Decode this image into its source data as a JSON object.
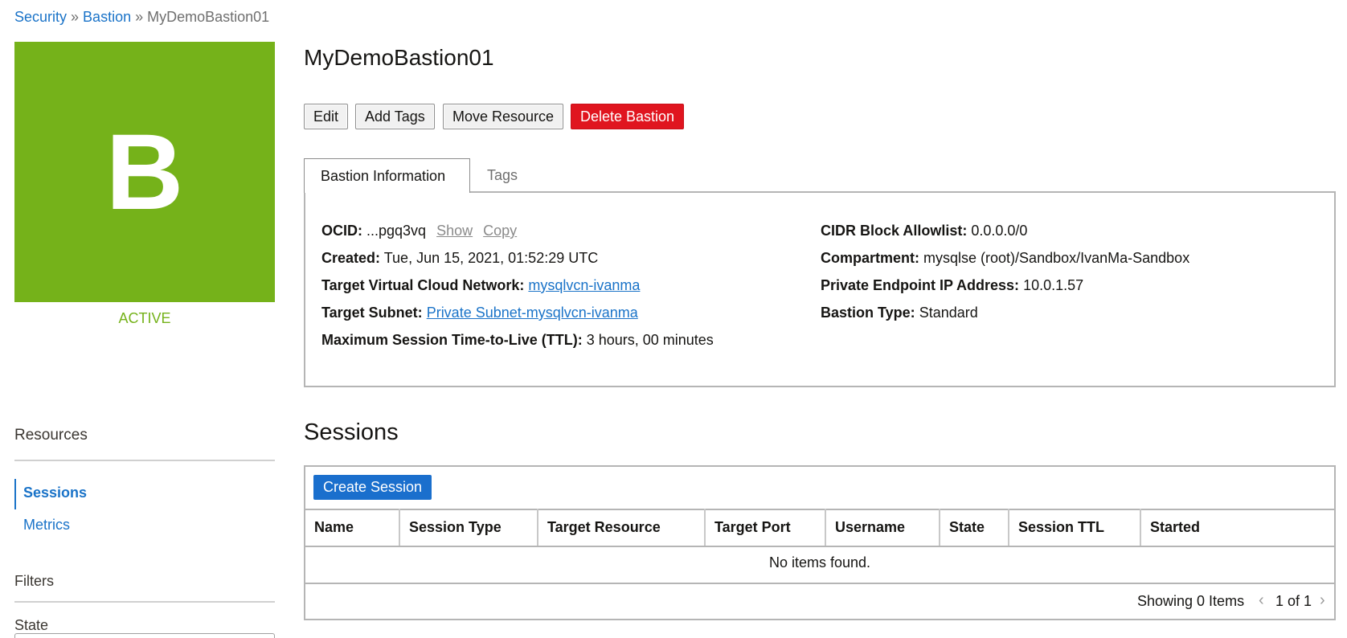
{
  "breadcrumb": {
    "items": [
      {
        "label": "Security"
      },
      {
        "label": "Bastion"
      },
      {
        "label": "MyDemoBastion01"
      }
    ],
    "separator": "»"
  },
  "avatar": {
    "letter": "B",
    "color": "#75b21a"
  },
  "status": {
    "label": "ACTIVE",
    "color": "#75b21a"
  },
  "sidebar": {
    "resources_heading": "Resources",
    "items": [
      {
        "label": "Sessions",
        "active": true
      },
      {
        "label": "Metrics",
        "active": false
      }
    ],
    "filters_heading": "Filters",
    "state_label": "State"
  },
  "page": {
    "title": "MyDemoBastion01"
  },
  "actions": {
    "edit": "Edit",
    "add_tags": "Add Tags",
    "move_resource": "Move Resource",
    "delete": "Delete Bastion"
  },
  "tabs": [
    {
      "label": "Bastion Information",
      "active": true
    },
    {
      "label": "Tags",
      "active": false
    }
  ],
  "info": {
    "ocid_label": "OCID:",
    "ocid_value": "...pgq3vq",
    "ocid_show": "Show",
    "ocid_copy": "Copy",
    "created_label": "Created:",
    "created_value": "Tue, Jun 15, 2021, 01:52:29 UTC",
    "vcn_label": "Target Virtual Cloud Network:",
    "vcn_value": "mysqlvcn-ivanma",
    "subnet_label": "Target Subnet:",
    "subnet_value": "Private Subnet-mysqlvcn-ivanma",
    "ttl_label": "Maximum Session Time-to-Live (TTL):",
    "ttl_value": "3 hours, 00 minutes",
    "cidr_label": "CIDR Block Allowlist:",
    "cidr_value": "0.0.0.0/0",
    "compartment_label": "Compartment:",
    "compartment_value": "mysqlse (root)/Sandbox/IvanMa-Sandbox",
    "endpoint_label": "Private Endpoint IP Address:",
    "endpoint_value": "10.0.1.57",
    "type_label": "Bastion Type:",
    "type_value": "Standard"
  },
  "sessions": {
    "title": "Sessions",
    "create_button": "Create Session",
    "columns": [
      "Name",
      "Session Type",
      "Target Resource",
      "Target Port",
      "Username",
      "State",
      "Session TTL",
      "Started"
    ],
    "empty_message": "No items found.",
    "showing": "Showing 0 Items",
    "page_indicator": "1 of 1",
    "prev_icon": "chevron-left-icon",
    "next_icon": "chevron-right-icon"
  },
  "colors": {
    "link": "#1a73c8",
    "danger": "#e0151f",
    "primary": "#1a6fcd"
  }
}
